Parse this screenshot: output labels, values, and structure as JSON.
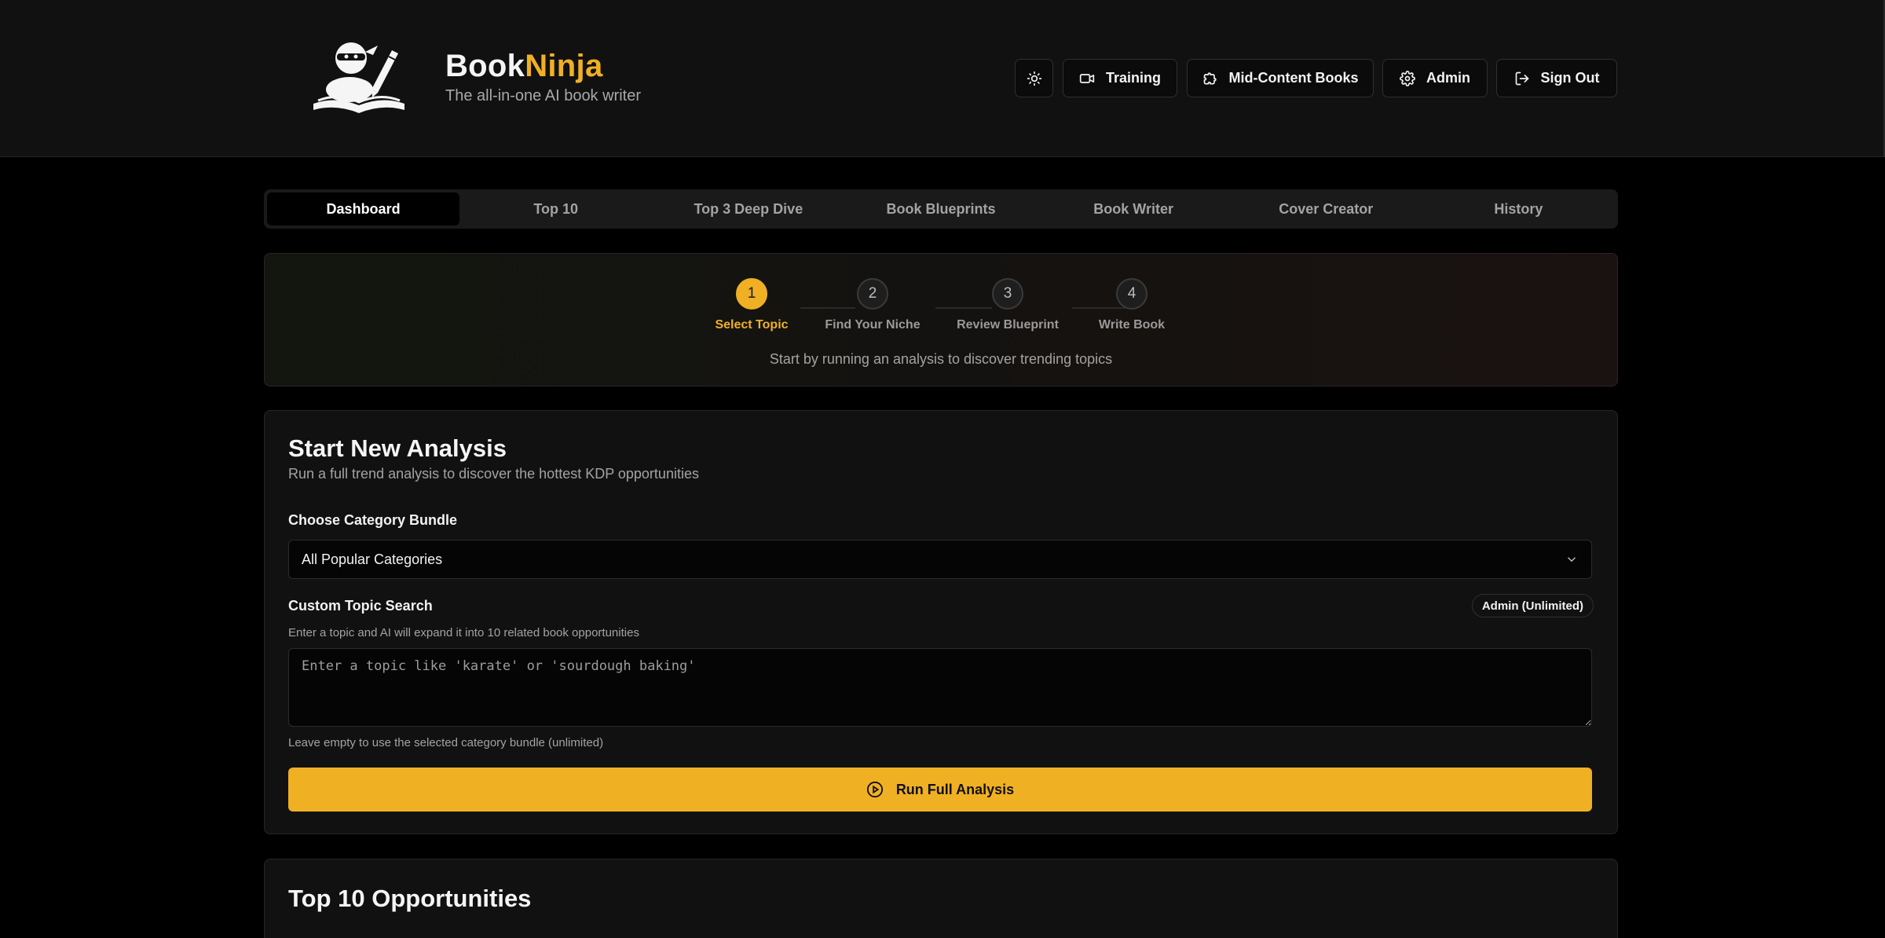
{
  "brand": {
    "name_part1": "Book",
    "name_part2": "Ninja",
    "tagline": "The all-in-one AI book writer"
  },
  "header_buttons": {
    "theme_icon": "sun-icon",
    "training": "Training",
    "mid_content": "Mid-Content Books",
    "admin": "Admin",
    "sign_out": "Sign Out"
  },
  "tabs": [
    {
      "label": "Dashboard",
      "active": true
    },
    {
      "label": "Top 10"
    },
    {
      "label": "Top 3 Deep Dive"
    },
    {
      "label": "Book Blueprints"
    },
    {
      "label": "Book Writer"
    },
    {
      "label": "Cover Creator"
    },
    {
      "label": "History"
    }
  ],
  "stepper": {
    "steps": [
      {
        "number": "1",
        "label": "Select Topic",
        "active": true
      },
      {
        "number": "2",
        "label": "Find Your Niche"
      },
      {
        "number": "3",
        "label": "Review Blueprint"
      },
      {
        "number": "4",
        "label": "Write Book"
      }
    ],
    "message": "Start by running an analysis to discover trending topics"
  },
  "analysis": {
    "title": "Start New Analysis",
    "subtitle": "Run a full trend analysis to discover the hottest KDP opportunities",
    "bundle_label": "Choose Category Bundle",
    "bundle_value": "All Popular Categories",
    "custom_label": "Custom Topic Search",
    "badge": "Admin (Unlimited)",
    "custom_hint": "Enter a topic and AI will expand it into 10 related book opportunities",
    "custom_placeholder": "Enter a topic like 'karate' or 'sourdough baking'",
    "empty_hint": "Leave empty to use the selected category bundle (unlimited)",
    "run_button": "Run Full Analysis"
  },
  "top10": {
    "title": "Top 10 Opportunities"
  },
  "colors": {
    "accent": "#f0b024",
    "background": "#000000",
    "panel": "#111111"
  }
}
